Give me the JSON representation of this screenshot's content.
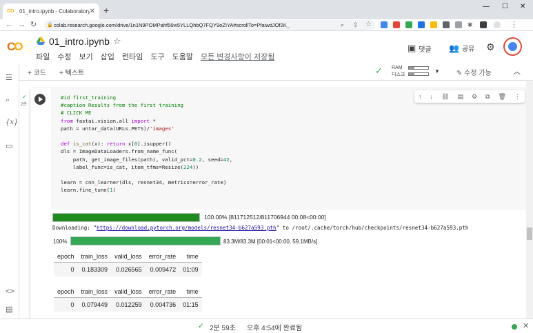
{
  "browser": {
    "tab_title": "01_intro.ipynb - Colaboratory",
    "tab_fav": "CO",
    "url": "colab.research.google.com/drive/1n1N9POMPahf56w5YLLQhbQ7FQY9oZIYA#scrollTo=PfaiwdJOf2K_",
    "win_min": "—",
    "win_max": "☐",
    "win_close": "✕"
  },
  "colab": {
    "logo_c": "C",
    "logo_o": "O",
    "notebook_title": "01_intro.ipynb",
    "menu": [
      "파일",
      "수정",
      "보기",
      "삽입",
      "런타임",
      "도구",
      "도움말"
    ],
    "saved_status": "모든 변경사항이 저장됨",
    "comment_label": "댓글",
    "share_label": "공유"
  },
  "toolbar": {
    "add_code": "+ 코드",
    "add_text": "+ 텍스트",
    "ram_label": "RAM",
    "disk_label": "디스크",
    "edit_mode": "수정 가능"
  },
  "cell": {
    "exec_time": "2분",
    "code": "#id first_training\n#caption Results from the first training\n# CLICK ME\nfrom fastai.vision.all import *\npath = untar_data(URLs.PETS)/'images'\n\ndef is_cat(x): return x[0].isupper()\ndls = ImageDataLoaders.from_name_func(\n    path, get_image_files(path), valid_pct=0.2, seed=42,\n    label_func=is_cat, item_tfms=Resize(224))\n\nlearn = cnn_learner(dls, resnet34, metrics=error_rate)\nlearn.fine_tune(1)"
  },
  "output": {
    "progress1_fraction": 1.0,
    "progress1_text": "100.00% [811712512/811706944 00:08<00:00]",
    "download_prefix": "Downloading: \"",
    "download_url": "https://download.pytorch.org/models/resnet34-b627a593.pth",
    "download_suffix": "\" to /root/.cache/torch/hub/checkpoints/resnet34-b627a593.pth",
    "progress2_pct": "100%",
    "progress2_fraction": 1.0,
    "progress2_text": "83.3M/83.3M [00:01<00:00, 59.1MB/s]",
    "table_headers": [
      "epoch",
      "train_loss",
      "valid_loss",
      "error_rate",
      "time"
    ],
    "table1_rows": [
      [
        "0",
        "0.183309",
        "0.026565",
        "0.009472",
        "01:09"
      ]
    ],
    "table2_rows": [
      [
        "0",
        "0.079449",
        "0.012259",
        "0.004736",
        "01:15"
      ]
    ]
  },
  "status": {
    "duration": "2분 59초",
    "completed": "오후 4:54에 완료됨"
  }
}
